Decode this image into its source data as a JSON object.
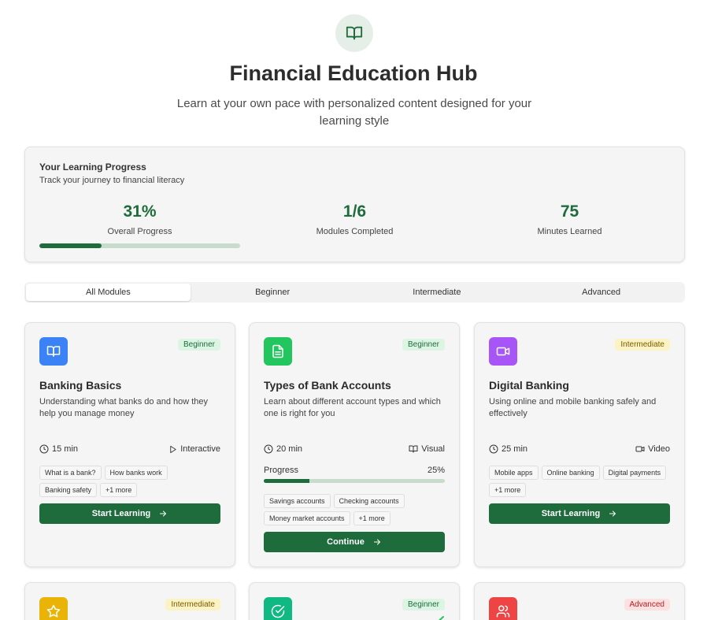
{
  "header": {
    "icon": "book-open-icon",
    "title": "Financial Education Hub",
    "subtitle": "Learn at your own pace with personalized content designed for your learning style"
  },
  "progress": {
    "title": "Your Learning Progress",
    "subtitle": "Track your journey to financial literacy",
    "overall_value": "31%",
    "overall_label": "Overall Progress",
    "overall_fraction": 0.31,
    "modules_value": "1/6",
    "modules_label": "Modules Completed",
    "minutes_value": "75",
    "minutes_label": "Minutes Learned"
  },
  "tabs": [
    {
      "label": "All Modules",
      "active": true
    },
    {
      "label": "Beginner",
      "active": false
    },
    {
      "label": "Intermediate",
      "active": false
    },
    {
      "label": "Advanced",
      "active": false
    }
  ],
  "colors": {
    "primary": "#1e6b3c",
    "blue": "#3b82f6",
    "green": "#22c55e",
    "purple": "#a855f7",
    "amber": "#eab308",
    "emerald": "#10b981",
    "red": "#ef4444"
  },
  "modules": [
    {
      "icon": "book-icon",
      "level": "Beginner",
      "title": "Banking Basics",
      "description": "Understanding what banks do and how they help you manage money",
      "duration": "15 min",
      "format_icon": "play-icon",
      "format": "Interactive",
      "tags": [
        "What is a bank?",
        "How banks work",
        "Banking safety",
        "+1 more"
      ],
      "button": "Start Learning"
    },
    {
      "icon": "document-icon",
      "level": "Beginner",
      "title": "Types of Bank Accounts",
      "description": "Learn about different account types and which one is right for you",
      "duration": "20 min",
      "format_icon": "book-icon",
      "format": "Visual",
      "progress_label": "Progress",
      "progress_value": "25%",
      "progress_fraction": 0.25,
      "tags": [
        "Savings accounts",
        "Checking accounts",
        "Money market accounts",
        "+1 more"
      ],
      "button": "Continue"
    },
    {
      "icon": "video-icon",
      "level": "Intermediate",
      "title": "Digital Banking",
      "description": "Using online and mobile banking safely and effectively",
      "duration": "25 min",
      "format_icon": "video-icon",
      "format": "Video",
      "tags": [
        "Mobile apps",
        "Online banking",
        "Digital payments",
        "+1 more"
      ],
      "button": "Start Learning"
    },
    {
      "icon": "star-icon",
      "level": "Intermediate"
    },
    {
      "icon": "check-circle-icon",
      "level": "Beginner"
    },
    {
      "icon": "users-icon",
      "level": "Advanced"
    }
  ]
}
